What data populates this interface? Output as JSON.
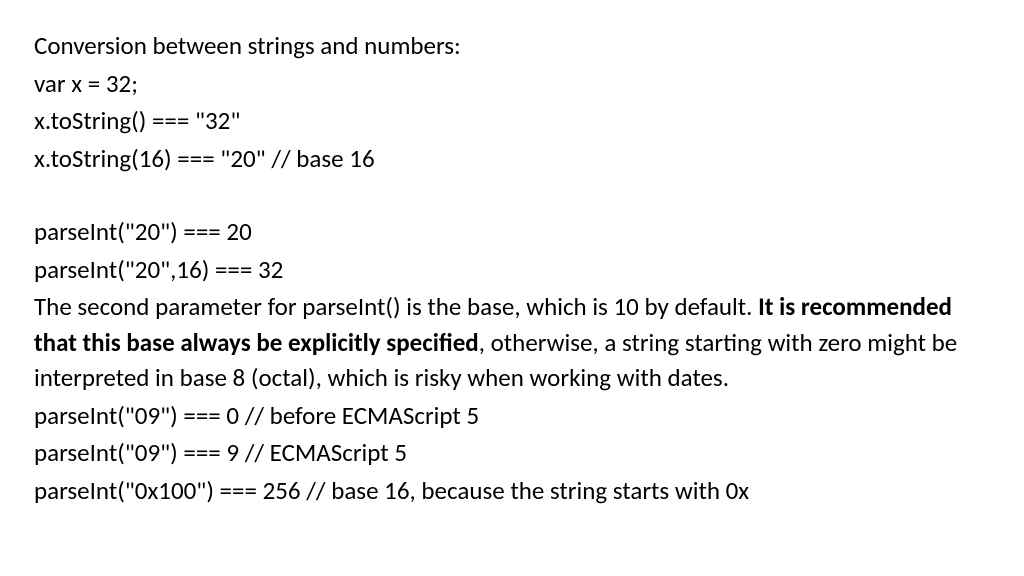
{
  "lines": {
    "l1": "Conversion between strings and numbers:",
    "l2": "var x = 32;",
    "l3": "x.toString() === \"32\"",
    "l4": "x.toString(16) === \"20\"  // base 16",
    "l5": "parseInt(\"20\") === 20",
    "l6": "parseInt(\"20\",16) === 32",
    "l7a": "The second parameter for parseInt() is the base, which is 10 by default.  ",
    "l7b": "It is recommended that this base always be explicitly specified",
    "l7c": ", otherwise, a string starting with zero might be interpreted in base 8 (octal), which is risky when working with dates.",
    "l8": "parseInt(\"09\") === 0 // before ECMAScript 5",
    "l9": "parseInt(\"09\") === 9 // ECMAScript 5",
    "l10": "parseInt(\"0x100\") === 256  // base 16, because the string starts with 0x"
  }
}
